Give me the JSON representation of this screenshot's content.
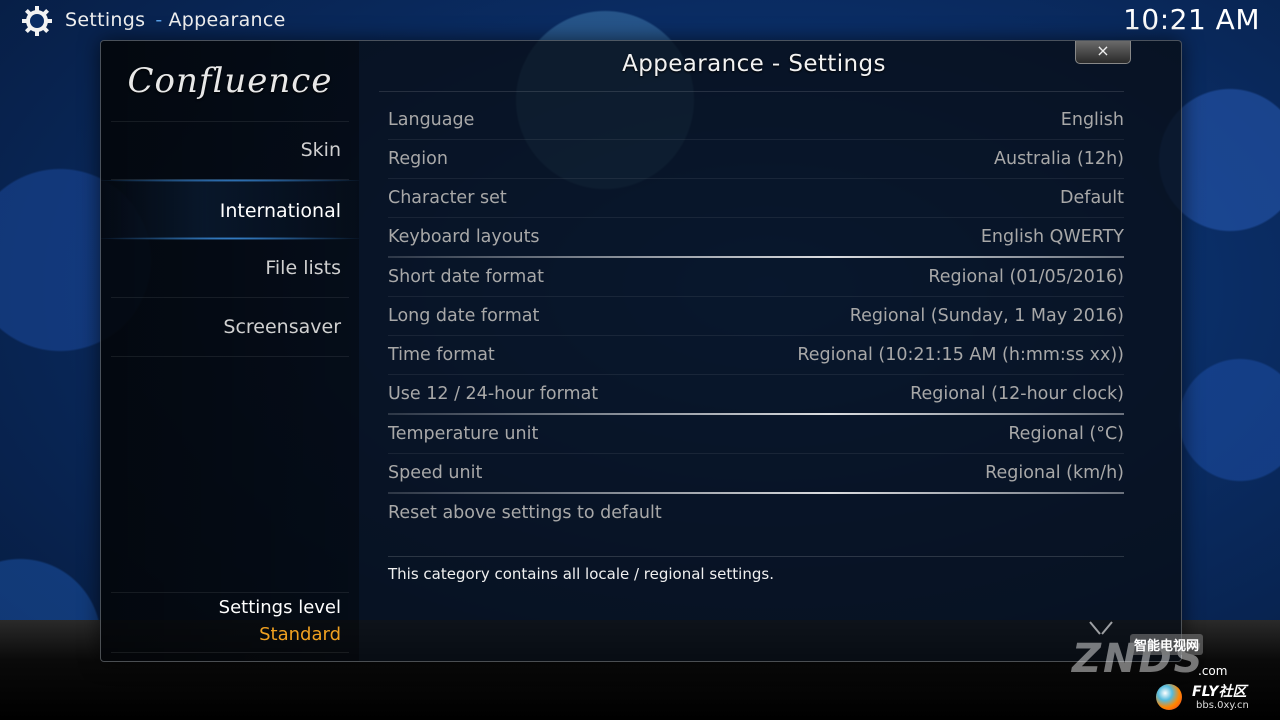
{
  "header": {
    "section": "Settings",
    "separator": "-",
    "page": "Appearance",
    "clock": "10:21 AM"
  },
  "dialog": {
    "title": "Appearance - Settings",
    "close_label": "×",
    "logo": "Confluence"
  },
  "sidebar": {
    "items": [
      {
        "label": "Skin",
        "active": false
      },
      {
        "label": "International",
        "active": true
      },
      {
        "label": "File lists",
        "active": false
      },
      {
        "label": "Screensaver",
        "active": false
      }
    ],
    "level_label": "Settings level",
    "level_value": "Standard"
  },
  "settings": [
    {
      "label": "Language",
      "value": "English"
    },
    {
      "label": "Region",
      "value": "Australia (12h)"
    },
    {
      "label": "Character set",
      "value": "Default"
    },
    {
      "label": "Keyboard layouts",
      "value": "English QWERTY"
    },
    {
      "label": "Short date format",
      "value": "Regional (01/05/2016)"
    },
    {
      "label": "Long date format",
      "value": "Regional (Sunday, 1 May 2016)"
    },
    {
      "label": "Time format",
      "value": "Regional (10:21:15 AM (h:mm:ss xx))"
    },
    {
      "label": "Use 12 / 24-hour format",
      "value": "Regional (12-hour clock)"
    },
    {
      "label": "Temperature unit",
      "value": "Regional (°C)"
    },
    {
      "label": "Speed unit",
      "value": "Regional (km/h)"
    },
    {
      "label": "Reset above settings to default",
      "value": ""
    }
  ],
  "description": "This category contains all locale / regional settings.",
  "watermark": {
    "brand": "ZNDS",
    "cn": "智能电视网",
    "com": ".com",
    "fly": "FLY社区",
    "bbs": "bbs.0xy.cn"
  },
  "colors": {
    "accent_blue": "#3b8fe0",
    "level_orange": "#f0a020",
    "background_blue": "#0a2c63"
  }
}
